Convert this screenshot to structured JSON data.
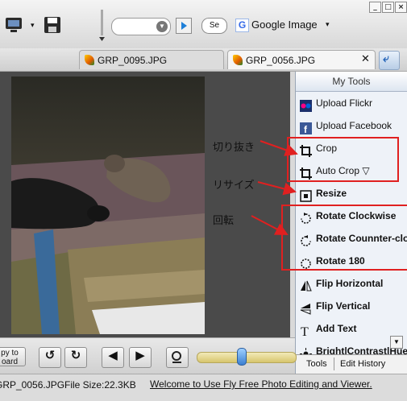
{
  "toolbar": {
    "window_buttons": [
      "_",
      "□",
      "×"
    ],
    "search_placeholder": "",
    "search_engine_short": "Se",
    "google_icon_letter": "G",
    "google_label": "Google Image",
    "google_dropdown": "▾"
  },
  "tabs": [
    {
      "label": "GRP_0095.JPG",
      "active": false
    },
    {
      "label": "GRP_0056.JPG",
      "active": true
    }
  ],
  "tab_close": "✕",
  "tools_panel": {
    "title": "My Tools",
    "items": [
      {
        "label": "Upload Flickr",
        "icon": "flickr-icon",
        "bold": false
      },
      {
        "label": "Upload Facebook",
        "icon": "facebook-icon",
        "bold": false
      },
      {
        "label": "Crop",
        "icon": "crop-icon",
        "bold": false
      },
      {
        "label": "Auto Crop ▽",
        "icon": "auto-crop-icon",
        "bold": false
      },
      {
        "label": "Resize",
        "icon": "resize-icon",
        "bold": true
      },
      {
        "label": "Rotate Clockwise",
        "icon": "rotate-clockwise-icon",
        "bold": true
      },
      {
        "label": "Rotate Counnter-clo",
        "icon": "rotate-counterclockwise-icon",
        "bold": true
      },
      {
        "label": "Rotate 180",
        "icon": "rotate-180-icon",
        "bold": true
      },
      {
        "label": "Flip Horizontal",
        "icon": "flip-horizontal-icon",
        "bold": true
      },
      {
        "label": "Flip Vertical",
        "icon": "flip-vertical-icon",
        "bold": true
      },
      {
        "label": "Add Text",
        "icon": "text-icon",
        "bold": true
      },
      {
        "label": "Bright|Contrast|Hue",
        "icon": "brightness-icon",
        "bold": true
      }
    ],
    "bottom_tabs": [
      "Tools",
      "Edit History"
    ]
  },
  "controls": {
    "copy_label_1": "py to",
    "copy_label_2": "oard",
    "rotate_left_glyph": "↺",
    "rotate_right_glyph": "↻",
    "prev_glyph": "◀",
    "next_glyph": "▶",
    "zoom_level": 0.45
  },
  "status": {
    "file": "GRP_0056.JPG",
    "size": "File Size:22.3KB",
    "link": "Welcome to Use Fly Free Photo Editing and Viewer."
  },
  "annotations": {
    "crop": "切り抜き",
    "resize": "リサイズ",
    "rotate": "回転"
  },
  "colors": {
    "annotation_red": "#e02020",
    "panel_bg": "#eef2f8",
    "zoom_track": "#d7c56d"
  }
}
